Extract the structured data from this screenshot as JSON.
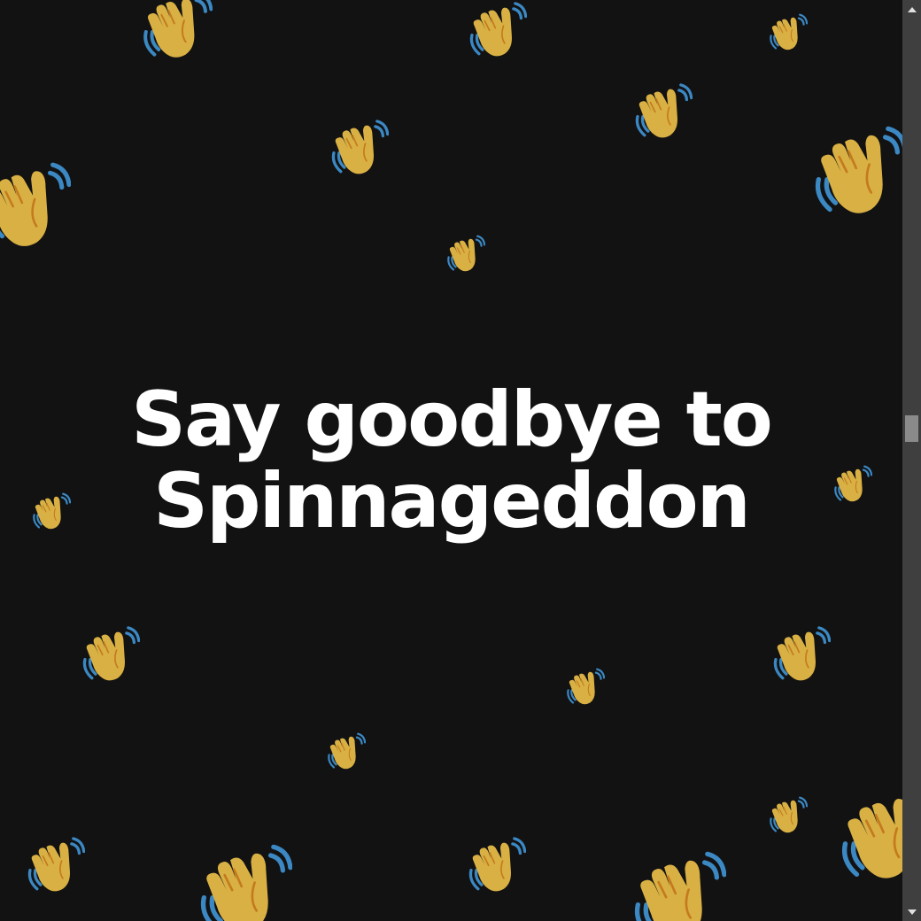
{
  "headline": {
    "line1": "Say goodbye to",
    "line2": "Spinnageddon"
  },
  "icons": {
    "wave": "waving-hand-icon"
  },
  "colors": {
    "background": "#121213",
    "text": "#ffffff",
    "hand": "#d9b043",
    "hand_line": "#c47a1e",
    "motion_lines": "#3b88c3",
    "scrollbar_track": "#3f3f40",
    "scrollbar_thumb": "#8a8a8a"
  }
}
